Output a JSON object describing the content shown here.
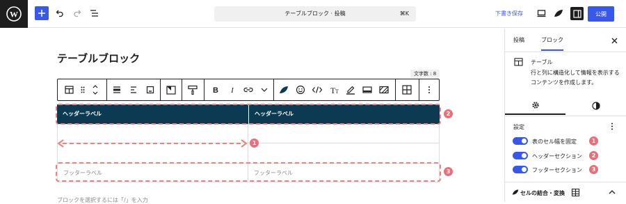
{
  "topbar": {
    "document_title": "テーブルブロック · 投稿",
    "shortcut": "⌘K",
    "draft_label": "下書き保存",
    "publish_label": "公開"
  },
  "editor": {
    "page_title": "テーブルブロック",
    "word_count": "文字数 : 8",
    "table": {
      "headers": [
        "ヘッダーラベル",
        "ヘッダーラベル"
      ],
      "footers": [
        "フッターラベル",
        "フッターラベル"
      ]
    },
    "hint": "ブロックを選択するには「/」を入力"
  },
  "annotations": [
    "1",
    "2",
    "3"
  ],
  "sidebar": {
    "tabs": [
      "投稿",
      "ブロック"
    ],
    "active_tab": "ブロック",
    "block_name": "テーブル",
    "block_description": "行と列に構造化して情報を表示するコンテンツを作成します。",
    "settings_title": "設定",
    "toggles": [
      {
        "label": "表のセル幅を固定",
        "on": true
      },
      {
        "label": "ヘッダーセクション",
        "on": true
      },
      {
        "label": "フッターセクション",
        "on": true
      }
    ],
    "merge_section": "セルの結合・変換"
  },
  "colors": {
    "accent": "#3858e9",
    "header_bg": "#0b3a52",
    "annotation": "#e9707a"
  }
}
